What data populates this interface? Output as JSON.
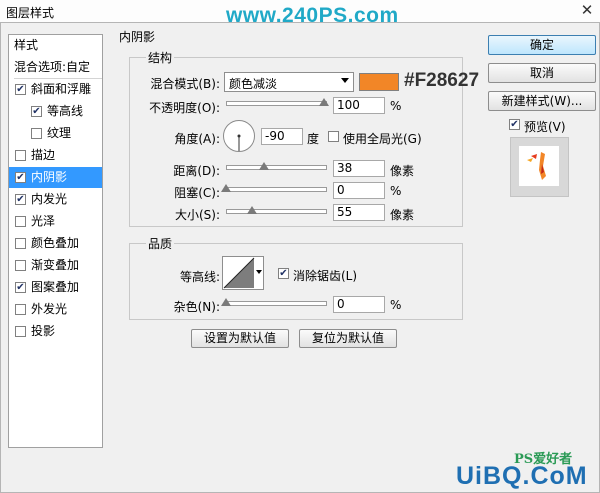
{
  "window": {
    "title": "图层样式",
    "watermark": "www.240PS.com",
    "close": "✕"
  },
  "style_list": {
    "header": "样式",
    "blend_options": "混合选项:自定",
    "items": [
      {
        "label": "斜面和浮雕",
        "checked": true,
        "selected": false
      },
      {
        "label": "等高线",
        "checked": true,
        "selected": false
      },
      {
        "label": "纹理",
        "checked": false,
        "selected": false
      },
      {
        "label": "描边",
        "checked": false,
        "selected": false
      },
      {
        "label": "内阴影",
        "checked": true,
        "selected": true
      },
      {
        "label": "内发光",
        "checked": true,
        "selected": false
      },
      {
        "label": "光泽",
        "checked": false,
        "selected": false
      },
      {
        "label": "颜色叠加",
        "checked": false,
        "selected": false
      },
      {
        "label": "渐变叠加",
        "checked": false,
        "selected": false
      },
      {
        "label": "图案叠加",
        "checked": true,
        "selected": false
      },
      {
        "label": "外发光",
        "checked": false,
        "selected": false
      },
      {
        "label": "投影",
        "checked": false,
        "selected": false
      }
    ]
  },
  "inner_shadow": {
    "section_title": "内阴影",
    "structure": {
      "title": "结构",
      "blend_mode_label": "混合模式(B):",
      "blend_mode_value": "颜色减淡",
      "color": "#F28627",
      "color_annotation": "#F28627",
      "opacity_label": "不透明度(O):",
      "opacity_value": "100",
      "opacity_unit": "%",
      "angle_label": "角度(A):",
      "angle_value": "-90",
      "angle_unit": "度",
      "global_light_label": "使用全局光(G)",
      "global_light_checked": false,
      "distance_label": "距离(D):",
      "distance_value": "38",
      "distance_unit": "像素",
      "choke_label": "阻塞(C):",
      "choke_value": "0",
      "choke_unit": "%",
      "size_label": "大小(S):",
      "size_value": "55",
      "size_unit": "像素"
    },
    "quality": {
      "title": "品质",
      "contour_label": "等高线:",
      "antialias_label": "消除锯齿(L)",
      "antialias_checked": true,
      "noise_label": "杂色(N):",
      "noise_value": "0",
      "noise_unit": "%"
    },
    "make_default": "设置为默认值",
    "reset_default": "复位为默认值"
  },
  "buttons": {
    "ok": "确定",
    "cancel": "取消",
    "new_style": "新建样式(W)..."
  },
  "preview": {
    "label": "预览(V)",
    "checked": true
  },
  "footer_watermark": {
    "logo": "PS爱好者",
    "site": "UiBQ.CoM"
  }
}
